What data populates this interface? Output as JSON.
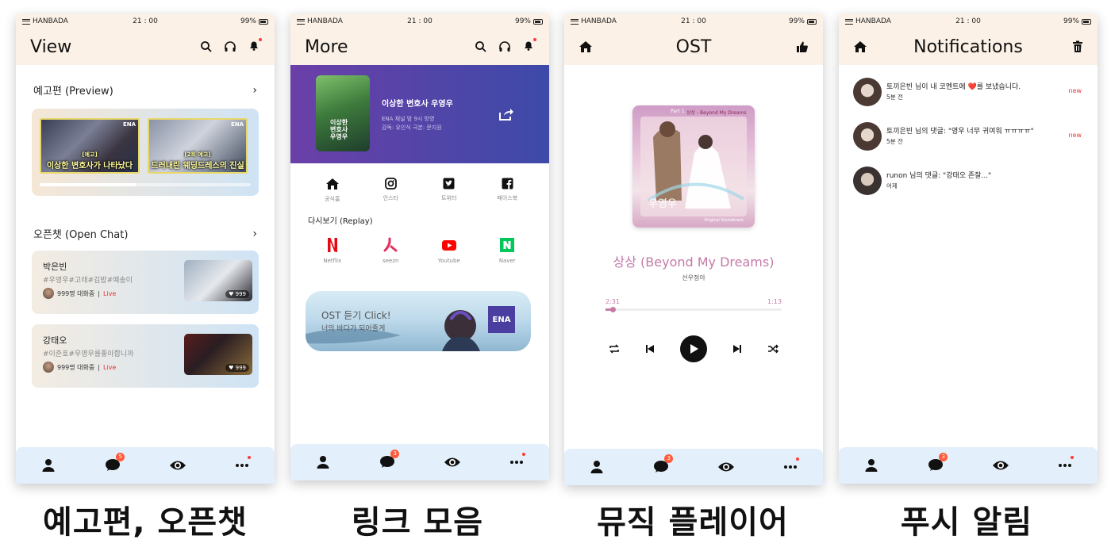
{
  "status": {
    "carrier": "HANBADA",
    "time": "21 : 00",
    "battery": "99%"
  },
  "captions": [
    "예고편, 오픈챗",
    "링크 모음",
    "뮤직 플레이어",
    "푸시 알림"
  ],
  "screen_view": {
    "title": "View",
    "preview_section": "예고편 (Preview)",
    "preview_thumbs": [
      "이상한 변호사가 나타났다",
      "드러내린 웨딩드레스의 진실"
    ],
    "preview_tags": [
      "[예고]",
      "[2회 예고]"
    ],
    "openchat_section": "오픈챗 (Open Chat)",
    "chats": [
      {
        "name": "박은빈",
        "tags": "#우영우#고래#김밥#예송이",
        "count": "999명 대화중",
        "live": "Live",
        "likes": "999"
      },
      {
        "name": "강태오",
        "tags": "#이준호#우영우를좋아합니까",
        "count": "999명 대화중",
        "live": "Live",
        "likes": "999"
      }
    ],
    "chevron": "›",
    "ena": "ENA"
  },
  "screen_more": {
    "title": "More",
    "drama_title": "이상한 변호사 우영우",
    "drama_info1": "ENA 채널 밤 9시 방영",
    "drama_info2": "감독: 유인식 극본: 문지원",
    "poster_text": "이상한\n변호사\n우영우",
    "links": [
      {
        "label": "공식홈",
        "icon": "home-icon"
      },
      {
        "label": "인스타",
        "icon": "instagram-icon"
      },
      {
        "label": "트위터",
        "icon": "twitter-icon"
      },
      {
        "label": "페이스북",
        "icon": "facebook-icon"
      }
    ],
    "replay_title": "다시보기 (Replay)",
    "replay": [
      {
        "label": "Netflix",
        "color": "#e50914"
      },
      {
        "label": "seezn",
        "color": "#e3325f"
      },
      {
        "label": "Youtube",
        "color": "#ff0000"
      },
      {
        "label": "Naver",
        "color": "#03c75a"
      }
    ],
    "ost_line1": "OST 듣기 Click!",
    "ost_line2": "너의 바다가 되어줄게",
    "ena": "ENA"
  },
  "screen_ost": {
    "title": "OST",
    "song": "상상 (Beyond My Dreams)",
    "artist": "선우정아",
    "elapsed": "2:31",
    "total": "1:13",
    "progress": 0.04,
    "album_part": "Part 1.",
    "album_song": "상상 - Beyond My Dreams",
    "album_artist": "선우정아",
    "album_drama": "이상한\n변호사\n우영우",
    "album_ost": "Original Soundtrack"
  },
  "screen_noti": {
    "title": "Notifications",
    "items": [
      {
        "msg": "토끼은빈 님이 내 코멘트에 ❤️를 보냈습니다.",
        "when": "5분 전",
        "new": "new"
      },
      {
        "msg": "토끼은빈 님의 댓글: \"영우 너무 귀여워 ㅠㅠㅠㅠ\"",
        "when": "5분 전",
        "new": "new"
      },
      {
        "msg": "runon 님의 댓글: \"강태오 존잘...\"",
        "when": "어제",
        "new": ""
      }
    ]
  },
  "nav_badges": {
    "view": "5",
    "more": "3",
    "ost": "3",
    "noti": "3"
  },
  "colors": {
    "header_bg": "#fbf1e6",
    "nav_bg": "#e3effa",
    "accent_pink": "#c57aa8",
    "banner_purple": "#5a3fa8",
    "live_red": "#e33333"
  }
}
